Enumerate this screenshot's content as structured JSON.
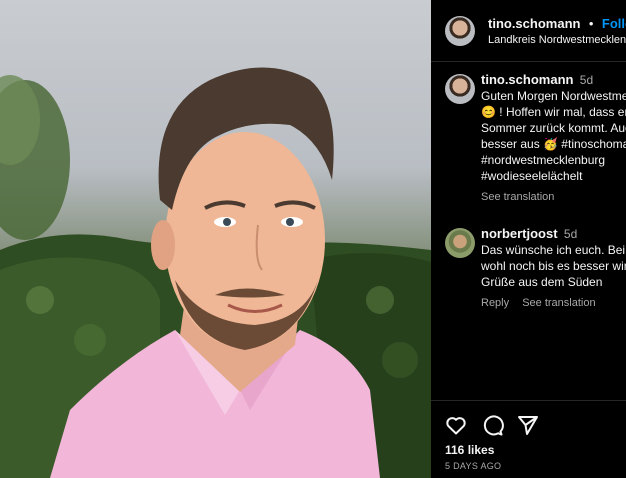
{
  "post": {
    "author": "tino.schomann",
    "separator": "•",
    "follow_label": "Follow",
    "location": "Landkreis Nordwestmecklenburg",
    "image_alt": "portrait photo of man in pink shirt"
  },
  "caption": {
    "username": "tino.schomann",
    "time": "5d",
    "lines": [
      "Guten Morgen Nordwestmecklenburg",
      "😊 ! Hoffen wir mal, dass endlich der",
      "Sommer zurück kommt. Auch so sieht es",
      "besser aus 🥳 #tinoschomann",
      "#nordwestmecklenburg",
      "#wodieseelelächelt"
    ],
    "see_translation": "See translation"
  },
  "reply": {
    "username": "norbertjoost",
    "time": "5d",
    "lines": [
      "Das wünsche ich euch. Bei uns dauert es",
      "wohl noch bis es besser wird. Viele",
      "Grüße aus dem Süden"
    ],
    "reply_label": "Reply",
    "see_translation": "See translation"
  },
  "footer": {
    "likes": "116 likes",
    "posted": "5 DAYS AGO"
  },
  "icons": {
    "like": "heart-icon",
    "comment": "comment-icon",
    "share": "paper-plane-icon"
  },
  "colors": {
    "background": "#000000",
    "text": "#f5f5f5",
    "secondary": "#a8a8a8",
    "link": "#0095f6",
    "shirt": "#f2b6d8"
  }
}
